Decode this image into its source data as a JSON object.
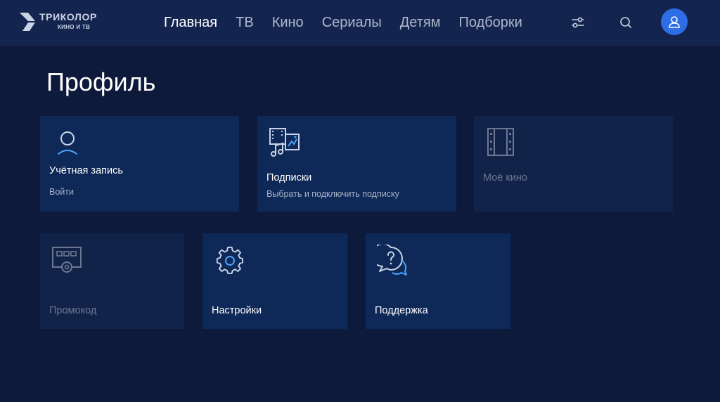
{
  "header": {
    "logo": {
      "title": "ТРИКОЛОР",
      "subtitle": "КИНО И ТВ"
    },
    "nav": [
      {
        "label": "Главная",
        "active": true
      },
      {
        "label": "ТВ",
        "active": false
      },
      {
        "label": "Кино",
        "active": false
      },
      {
        "label": "Сериалы",
        "active": false
      },
      {
        "label": "Детям",
        "active": false
      },
      {
        "label": "Подборки",
        "active": false
      }
    ],
    "icons": {
      "filter": "sliders-icon",
      "search": "search-icon",
      "profile": "user-icon"
    }
  },
  "page": {
    "title": "Профиль"
  },
  "tiles": {
    "account": {
      "label": "Учётная запись",
      "sub": "Войти",
      "icon": "user-icon"
    },
    "subscriptions": {
      "label": "Подписки",
      "sub": "Выбрать и подключить подписку",
      "icon": "media-icon"
    },
    "my_kino": {
      "label": "Моё кино",
      "icon": "film-icon",
      "disabled": true
    },
    "promo": {
      "label": "Промокод",
      "icon": "promo-code-icon",
      "disabled": true
    },
    "settings": {
      "label": "Настройки",
      "icon": "gear-icon"
    },
    "support": {
      "label": "Поддержка",
      "icon": "help-chat-icon"
    }
  },
  "colors": {
    "background": "#0e1a3b",
    "header": "#13244f",
    "tile": "#0e2857",
    "tile_disabled": "#12234a",
    "accent": "#2d6ee6",
    "icon_accent": "#4aa3ff"
  }
}
